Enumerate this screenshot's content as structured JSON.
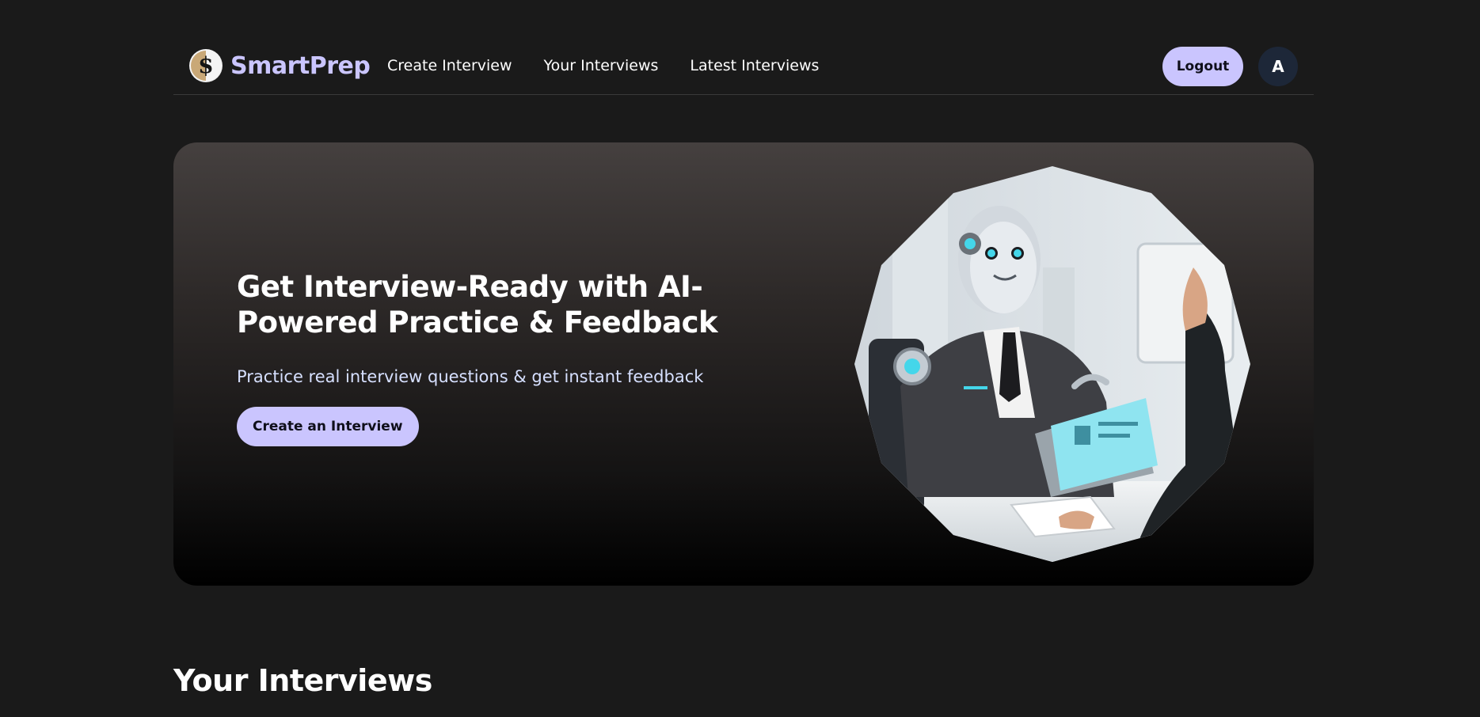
{
  "brand": {
    "name": "SmartPrep",
    "logo_icon": "dollar-coin-icon"
  },
  "nav": {
    "links": [
      "Create Interview",
      "Your Interviews",
      "Latest Interviews"
    ],
    "logout_label": "Logout",
    "avatar_initial": "A"
  },
  "hero": {
    "title": "Get Interview-Ready with AI-Powered Practice & Feedback",
    "subtitle": "Practice real interview questions & get instant feedback",
    "cta_label": "Create an Interview",
    "image": "robot-interviewer-illustration"
  },
  "sections": {
    "your_interviews_title": "Your Interviews"
  },
  "colors": {
    "background": "#1a1a1a",
    "accent": "#cac5fe",
    "avatar_bg": "#1d2738",
    "subtitle": "#d6e0ff"
  }
}
